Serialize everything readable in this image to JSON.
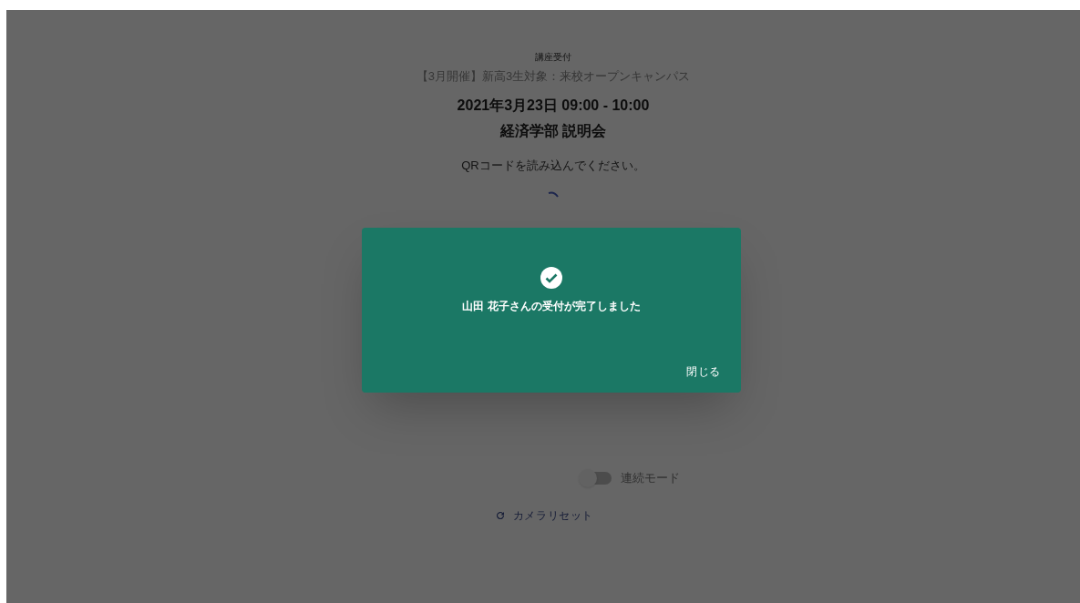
{
  "page": {
    "section_label": "講座受付",
    "event_title": "【3月開催】新高3生対象：来校オープンキャンパス",
    "datetime": "2021年3月23日 09:00 - 10:00",
    "session_name": "経済学部 説明会",
    "instruction": "QRコードを読み込んでください。",
    "loading": true
  },
  "continuous_mode": {
    "label": "連続モード",
    "on": false
  },
  "camera_reset": {
    "label": "カメラリセット"
  },
  "dialog": {
    "message": "山田 花子さんの受付が完了しました",
    "close_label": "閉じる"
  }
}
